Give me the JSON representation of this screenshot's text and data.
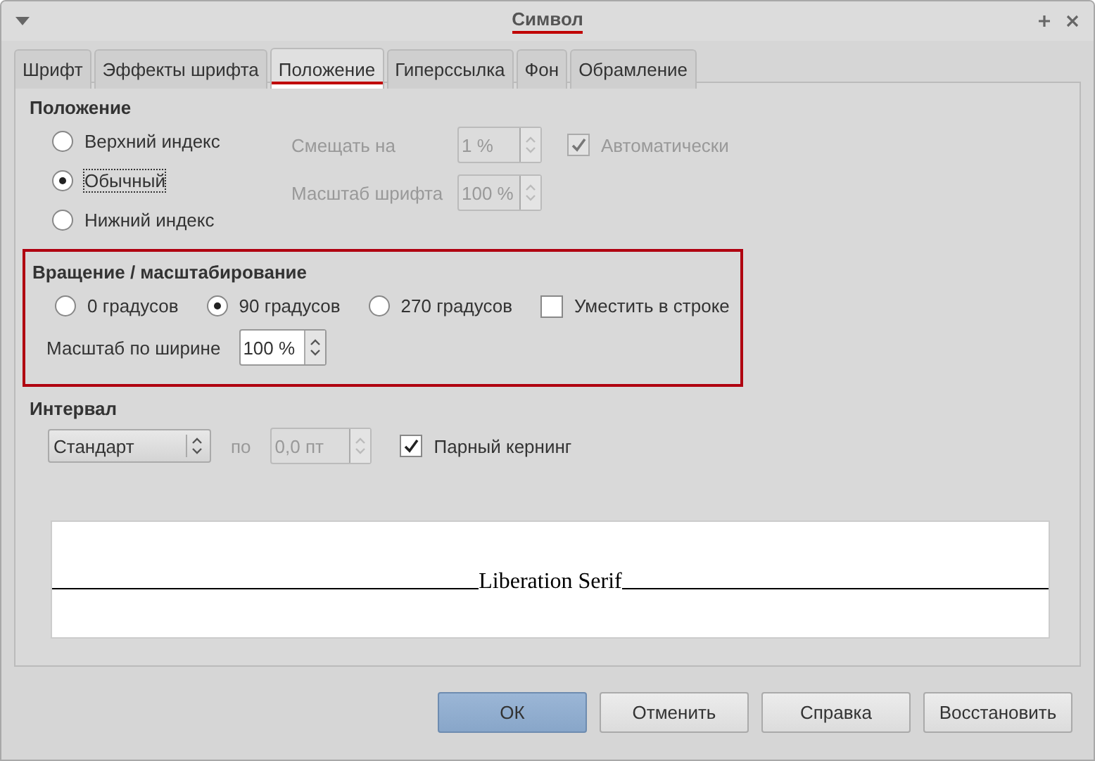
{
  "window": {
    "title": "Символ",
    "title_highlighted": true
  },
  "tabs": [
    {
      "label": "Шрифт",
      "selected": false,
      "highlighted": false
    },
    {
      "label": "Эффекты шрифта",
      "selected": false,
      "highlighted": false
    },
    {
      "label": "Положение",
      "selected": true,
      "highlighted": true
    },
    {
      "label": "Гиперссылка",
      "selected": false,
      "highlighted": false
    },
    {
      "label": "Фон",
      "selected": false,
      "highlighted": false
    },
    {
      "label": "Обрамление",
      "selected": false,
      "highlighted": false
    }
  ],
  "position": {
    "heading": "Положение",
    "options": [
      {
        "label": "Верхний индекс",
        "selected": false
      },
      {
        "label": "Обычный",
        "selected": true
      },
      {
        "label": "Нижний индекс",
        "selected": false
      }
    ],
    "offset": {
      "label": "Смещать на",
      "value": "1 %",
      "disabled": true
    },
    "font_scale": {
      "label": "Масштаб шрифта",
      "value": "100 %",
      "disabled": true
    },
    "auto": {
      "label": "Автоматически",
      "checked": true,
      "disabled": true
    }
  },
  "rotation": {
    "heading": "Вращение / масштабирование",
    "highlighted": true,
    "options": [
      {
        "label": "0 градусов",
        "selected": false
      },
      {
        "label": "90 градусов",
        "selected": true
      },
      {
        "label": "270 градусов",
        "selected": false
      }
    ],
    "fit": {
      "label": "Уместить в строке",
      "checked": false
    },
    "width_scale": {
      "label": "Масштаб по ширине",
      "value": "100 %",
      "disabled": false
    }
  },
  "spacing": {
    "heading": "Интервал",
    "mode": "Стандарт",
    "by_label": "по",
    "by": {
      "value": "0,0 пт",
      "disabled": true
    },
    "kerning": {
      "label": "Парный кернинг",
      "checked": true
    }
  },
  "preview": {
    "text": "Liberation Serif"
  },
  "buttons": [
    {
      "label": "ОК",
      "default": true
    },
    {
      "label": "Отменить",
      "default": false
    },
    {
      "label": "Справка",
      "default": false
    },
    {
      "label": "Восстановить",
      "default": false
    }
  ]
}
